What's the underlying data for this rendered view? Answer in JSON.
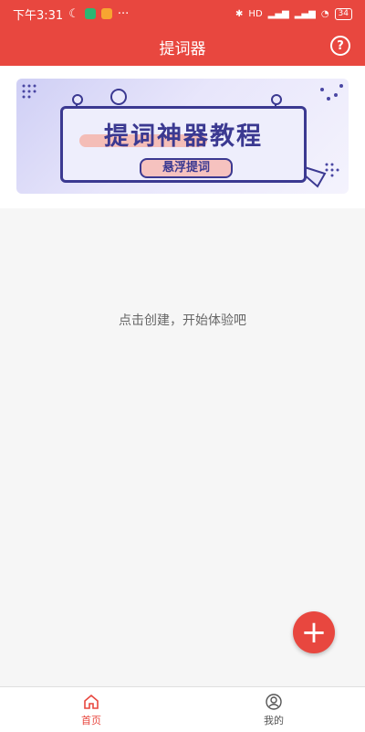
{
  "status_bar": {
    "time": "下午3:31",
    "more": "···",
    "battery": "34",
    "network": "HD"
  },
  "header": {
    "title": "提词器",
    "help_symbol": "?"
  },
  "banner": {
    "title": "提词神器教程",
    "tag": "悬浮提词"
  },
  "main": {
    "empty_hint": "点击创建，开始体验吧"
  },
  "fab": {
    "symbol": "+"
  },
  "bottom_nav": {
    "tabs": [
      {
        "label": "首页",
        "icon": "home-icon",
        "active": true
      },
      {
        "label": "我的",
        "icon": "user-icon",
        "active": false
      }
    ]
  },
  "colors": {
    "primary": "#e8473f",
    "banner_ink": "#3b3991"
  }
}
